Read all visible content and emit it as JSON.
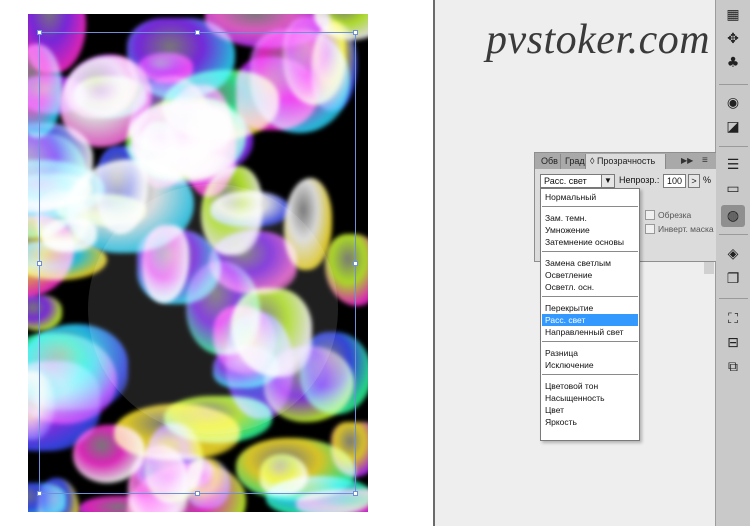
{
  "watermark": "pvstoker.com",
  "panel": {
    "tabs": [
      "Обв",
      "Град",
      "Прозрачность"
    ],
    "tab_arrows": "▶▶",
    "menu_icon": "≡",
    "blend_mode": "Расс. свет",
    "dropdown_arrow": "▼",
    "opacity_label": "Непрозр.:",
    "opacity_value": "100",
    "opacity_arrow": ">",
    "percent": "%",
    "clip_label": "Обрезка",
    "invert_mask_label": "Инверт. маска"
  },
  "blend_groups": [
    [
      "Нормальный"
    ],
    [
      "Зам. темн.",
      "Умножение",
      "Затемнение основы"
    ],
    [
      "Замена светлым",
      "Осветление",
      "Осветл. осн."
    ],
    [
      "Перекрытие",
      "Расс. свет",
      "Направленный свет"
    ],
    [
      "Разница",
      "Исключение"
    ],
    [
      "Цветовой тон",
      "Насыщенность",
      "Цвет",
      "Яркость"
    ]
  ],
  "selected_blend": "Расс. свет",
  "toolbar": [
    {
      "name": "swatches-icon",
      "glyph": "▦"
    },
    {
      "name": "brushes-icon",
      "glyph": "✥"
    },
    {
      "name": "symbols-icon",
      "glyph": "♣"
    },
    {
      "name": "appearance-icon",
      "glyph": "◉"
    },
    {
      "name": "graphic-styles-icon",
      "glyph": "◪"
    },
    {
      "name": "stroke-icon",
      "glyph": "☰"
    },
    {
      "name": "gradient-icon",
      "glyph": "▭"
    },
    {
      "name": "transparency-icon",
      "glyph": "◍"
    },
    {
      "name": "layers-icon",
      "glyph": "◈"
    },
    {
      "name": "artboards-icon",
      "glyph": "❐"
    },
    {
      "name": "transform-icon",
      "glyph": "⛶"
    },
    {
      "name": "align-icon",
      "glyph": "⊟"
    },
    {
      "name": "pathfinder-icon",
      "glyph": "⧉"
    }
  ]
}
